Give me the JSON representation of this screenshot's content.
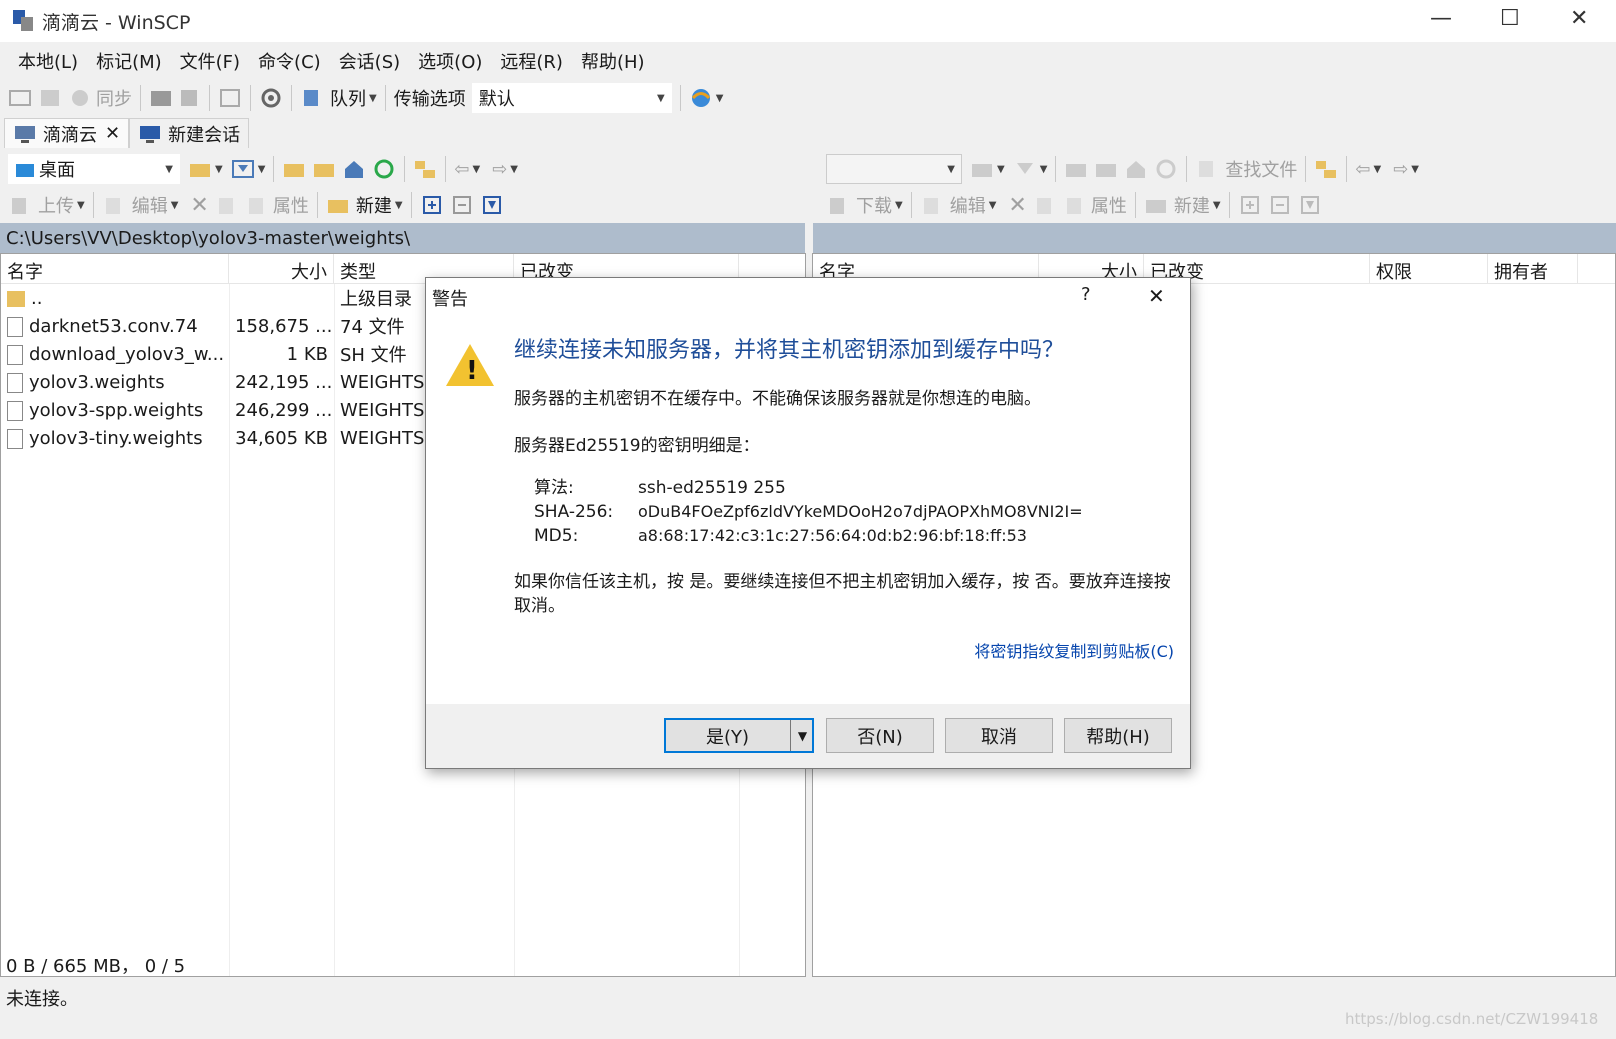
{
  "window": {
    "title": "滴滴云 - WinSCP",
    "minimize": "—",
    "maximize": "☐",
    "close": "✕"
  },
  "menu": [
    "本地(L)",
    "标记(M)",
    "文件(F)",
    "命令(C)",
    "会话(S)",
    "选项(O)",
    "远程(R)",
    "帮助(H)"
  ],
  "toolbar": {
    "sync": "同步",
    "queue": "队列",
    "transfer_options": "传输选项",
    "transfer_value": "默认"
  },
  "tabs": [
    {
      "label": "滴滴云"
    },
    {
      "label": "新建会话"
    }
  ],
  "local": {
    "drive": "桌面",
    "upload": "上传",
    "edit": "编辑",
    "props": "属性",
    "new": "新建",
    "path": "C:\\Users\\VV\\Desktop\\yolov3-master\\weights\\",
    "columns": [
      "名字",
      "大小",
      "类型",
      "已改变"
    ],
    "files": [
      {
        "name": "..",
        "size": "",
        "type": "上级目录"
      },
      {
        "name": "darknet53.conv.74",
        "size": "158,675 ...",
        "type": "74 文件"
      },
      {
        "name": "download_yolov3_w...",
        "size": "1 KB",
        "type": "SH 文件"
      },
      {
        "name": "yolov3.weights",
        "size": "242,195 ...",
        "type": "WEIGHTS"
      },
      {
        "name": "yolov3-spp.weights",
        "size": "246,299 ...",
        "type": "WEIGHTS"
      },
      {
        "name": "yolov3-tiny.weights",
        "size": "34,605 KB",
        "type": "WEIGHTS"
      }
    ]
  },
  "remote": {
    "find": "查找文件",
    "download": "下载",
    "edit": "编辑",
    "props": "属性",
    "new": "新建",
    "columns": [
      "名字",
      "大小",
      "已改变",
      "权限",
      "拥有者"
    ]
  },
  "status": {
    "line1": "0 B / 665 MB， 0 / 5",
    "line2": "未连接。"
  },
  "watermark": "https://blog.csdn.net/CZW199418",
  "dialog": {
    "title": "警告",
    "help_q": "?",
    "close": "✕",
    "heading": "继续连接未知服务器，并将其主机密钥添加到缓存中吗？",
    "p1": "服务器的主机密钥不在缓存中。不能确保该服务器就是你想连的电脑。",
    "p2": "服务器Ed25519的密钥明细是：",
    "details": [
      {
        "k": "算法:",
        "v": "ssh-ed25519 255"
      },
      {
        "k": "SHA-256:",
        "v": "oDuB4FOeZpf6zldVYkeMDOoH2o7djPAOPXhMO8VNI2I="
      },
      {
        "k": "MD5:",
        "v": "a8:68:17:42:c3:1c:27:56:64:0d:b2:96:bf:18:ff:53"
      }
    ],
    "p3": "如果你信任该主机，按 是。要继续连接但不把主机密钥加入缓存，按 否。要放弃连接按 取消。",
    "copy_link": "将密钥指纹复制到剪贴板(C)",
    "buttons": {
      "yes": "是(Y)",
      "no": "否(N)",
      "cancel": "取消",
      "help": "帮助(H)"
    }
  },
  "colors": {
    "accent": "#0078d7",
    "heading": "#1f4e99",
    "link": "#0645ad",
    "pathbar": "#aebccc"
  }
}
